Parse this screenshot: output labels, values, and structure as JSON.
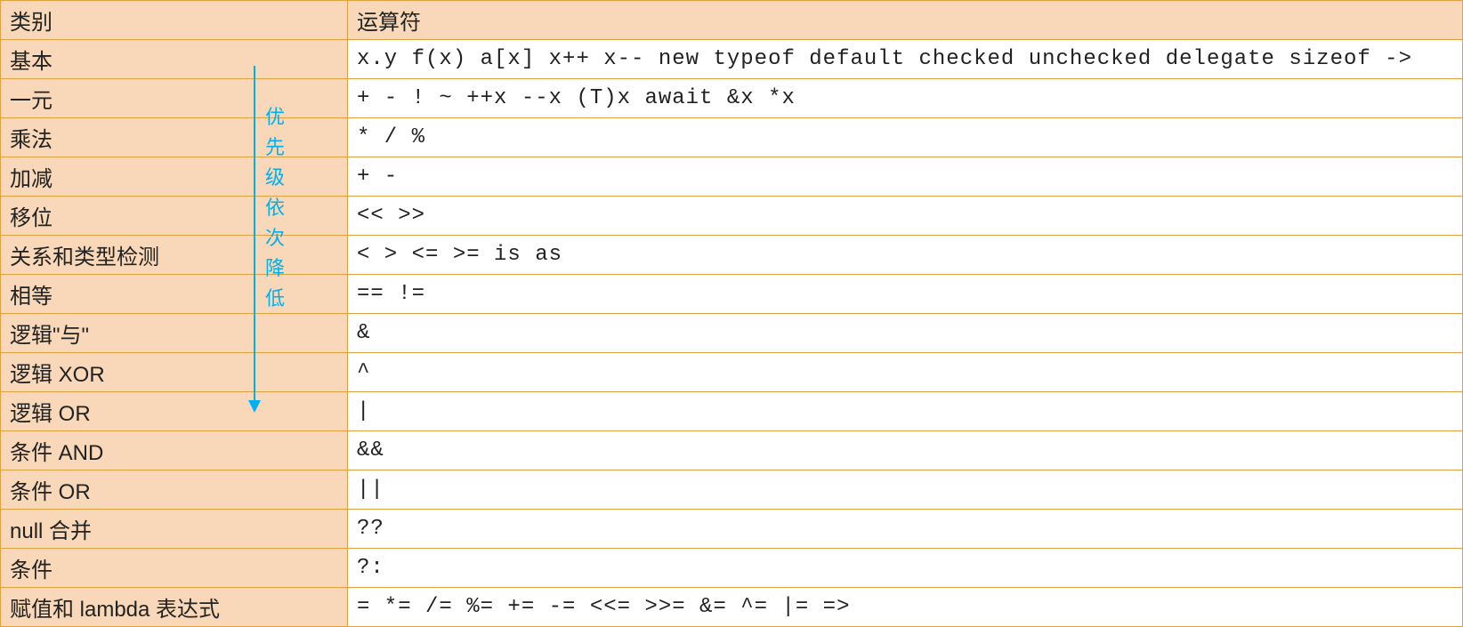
{
  "headers": {
    "category": "类别",
    "operator": "运算符"
  },
  "rows": [
    {
      "category": "基本",
      "operator": "x.y  f(x)  a[x]  x++  x--  new  typeof  default  checked  unchecked  delegate  sizeof  ->"
    },
    {
      "category": "一元",
      "operator": "+  -  !  ~  ++x  --x  (T)x  await  &x  *x"
    },
    {
      "category": "乘法",
      "operator": "*  /  %"
    },
    {
      "category": "加减",
      "operator": "+  -"
    },
    {
      "category": "移位",
      "operator": "<<  >>"
    },
    {
      "category": "关系和类型检测",
      "operator": "<  >  <=  >=  is  as"
    },
    {
      "category": "相等",
      "operator": "==  !="
    },
    {
      "category": "逻辑\"与\"",
      "operator": "&"
    },
    {
      "category": "逻辑 XOR",
      "operator": "^"
    },
    {
      "category": "逻辑 OR",
      "operator": "|"
    },
    {
      "category": "条件 AND",
      "operator": "&&"
    },
    {
      "category": "条件 OR",
      "operator": "||"
    },
    {
      "category": "null 合并",
      "operator": "??"
    },
    {
      "category": "条件",
      "operator": "?:"
    },
    {
      "category": "赋值和 lambda 表达式",
      "operator": "=  *=  /=  %=  +=  -=  <<=  >>=  &=  ^=  |=  =>"
    }
  ],
  "annotation": {
    "text": "优先级依次降低",
    "chars": [
      "优",
      "先",
      "级",
      "依",
      "次",
      "降",
      "低"
    ]
  },
  "chart_data": {
    "type": "table",
    "title": "运算符优先级表",
    "columns": [
      "类别",
      "运算符"
    ],
    "rows": [
      [
        "基本",
        "x.y  f(x)  a[x]  x++  x--  new  typeof  default  checked  unchecked  delegate  sizeof  ->"
      ],
      [
        "一元",
        "+  -  !  ~  ++x  --x  (T)x  await  &x  *x"
      ],
      [
        "乘法",
        "*  /  %"
      ],
      [
        "加减",
        "+  -"
      ],
      [
        "移位",
        "<<  >>"
      ],
      [
        "关系和类型检测",
        "<  >  <=  >=  is  as"
      ],
      [
        "相等",
        "==  !="
      ],
      [
        "逻辑\"与\"",
        "&"
      ],
      [
        "逻辑 XOR",
        "^"
      ],
      [
        "逻辑 OR",
        "|"
      ],
      [
        "条件 AND",
        "&&"
      ],
      [
        "条件 OR",
        "||"
      ],
      [
        "null 合并",
        "??"
      ],
      [
        "条件",
        "?:"
      ],
      [
        "赋值和 lambda 表达式",
        "=  *=  /=  %=  +=  -=  <<=  >>=  &=  ^=  |=  =>"
      ]
    ],
    "annotation": "优先级依次降低 (priority decreases downward)"
  }
}
